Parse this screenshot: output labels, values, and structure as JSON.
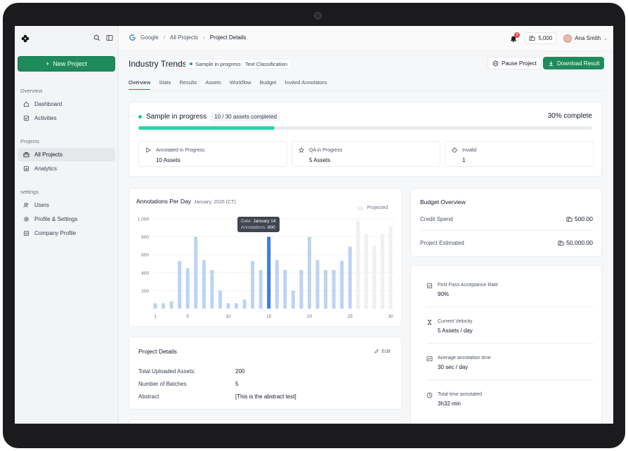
{
  "sidebar": {
    "new_project": "New Project",
    "sections": [
      {
        "title": "Overview",
        "items": [
          "Dashboard",
          "Activities"
        ]
      },
      {
        "title": "Projects",
        "items": [
          "All Projects",
          "Analytics"
        ]
      },
      {
        "title": "settings",
        "items": [
          "Users",
          "Profile & Settings",
          "Company Profile"
        ]
      }
    ]
  },
  "topbar": {
    "breadcrumbs": [
      "Google",
      "All Projects",
      "Project Details"
    ],
    "notifications": "3",
    "credits": "5,000",
    "user": "Ana Smith"
  },
  "header": {
    "title": "Industry Trends",
    "status_tag": "Sample in progress",
    "type_tag": "Text Classification",
    "pause_label": "Pause Project",
    "download_label": "Download Result"
  },
  "tabs": [
    "Overview",
    "Stats",
    "Results",
    "Assets",
    "Workflow",
    "Budget",
    "Invited Annotators"
  ],
  "progress": {
    "status": "Sample in progress",
    "count": "10 / 30 assets completed",
    "percent_label": "30% complete",
    "percent": 0.3,
    "stats": [
      {
        "label": "Annotated in Progress",
        "value": "10 Assets"
      },
      {
        "label": "QA in Progress",
        "value": "5 Assets"
      },
      {
        "label": "Invalid",
        "value": "1"
      }
    ]
  },
  "chart": {
    "title": "Annotations Per Day",
    "subtitle": "January, 2026 (CT)",
    "legend_projected": "Projected",
    "tooltip_date_key": "Date:",
    "tooltip_date": "January 14",
    "tooltip_value_key": "Annotations:",
    "tooltip_value": "800"
  },
  "chart_data": {
    "type": "bar",
    "xlabel": "",
    "ylabel": "",
    "ylim": [
      0,
      1000
    ],
    "y_ticks": [
      "200",
      "400",
      "600",
      "800",
      "1,000"
    ],
    "x_ticks": [
      "1",
      "5",
      "10",
      "15",
      "20",
      "25",
      "30"
    ],
    "x": [
      1,
      2,
      3,
      4,
      5,
      6,
      7,
      8,
      9,
      10,
      11,
      12,
      13,
      14,
      15,
      16,
      17,
      18,
      19,
      20,
      21,
      22,
      23,
      24,
      25,
      26,
      27,
      28,
      29,
      30
    ],
    "values": [
      60,
      60,
      80,
      530,
      450,
      800,
      540,
      430,
      200,
      60,
      60,
      100,
      530,
      430,
      800,
      540,
      430,
      200,
      430,
      800,
      540,
      430,
      430,
      530,
      690,
      980,
      830,
      700,
      830,
      920
    ],
    "projected_from_day": 26,
    "highlight_day": 15,
    "colors": {
      "bar": "#bcd3f5",
      "highlight": "#3b7be0",
      "projected": "#eef0f2"
    }
  },
  "budget": {
    "title": "Budget Overview",
    "credit_spend_label": "Credit Spend",
    "credit_spend": "500.00",
    "estimated_label": "Project Estimated",
    "estimated": "50,000.00"
  },
  "metrics": [
    {
      "label": "First Pass Acceptance Rate",
      "value": "90%"
    },
    {
      "label": "Current Velocity",
      "value": "5 Assets / day"
    },
    {
      "label": "Average annotation time",
      "value": "30 sec / day"
    },
    {
      "label": "Total time annotated",
      "value": "3h32 min"
    }
  ],
  "details": {
    "title": "Project Details",
    "edit": "Edit",
    "rows": [
      {
        "label": "Total Uploaded Assets:",
        "value": "200"
      },
      {
        "label": "Number of Batches",
        "value": "5"
      },
      {
        "label": "Abstract",
        "value": "[This is the abstract test]"
      }
    ]
  }
}
